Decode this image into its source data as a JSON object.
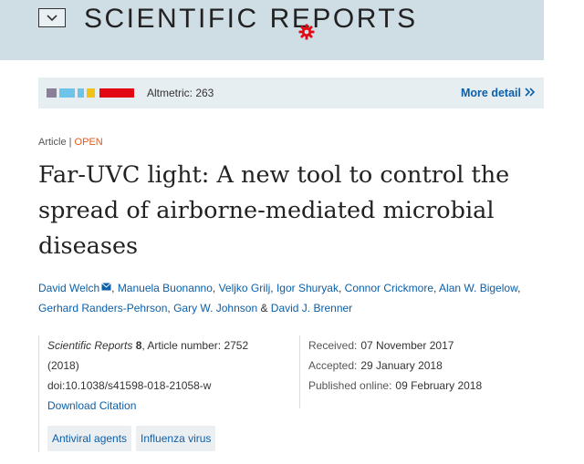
{
  "header": {
    "logo_left": "SCIENTIFIC",
    "logo_right": "REPORTS",
    "menu_icon": "chevron-down-icon"
  },
  "altmetric": {
    "label": "Altmetric: 263",
    "more_detail": "More detail",
    "swatch_colors": [
      "#8a7f96",
      "#6ec3e8",
      "#6ec3e8",
      "#f2c21c",
      "#e30613",
      "#e30613",
      "#e30613"
    ]
  },
  "article": {
    "type": "Article",
    "access": "OPEN",
    "title": "Far-UVC light: A new tool to control the spread of airborne-mediated microbial diseases"
  },
  "authors": [
    {
      "name": "David Welch",
      "mail": true
    },
    {
      "name": "Manuela Buonanno"
    },
    {
      "name": "Veljko Grilj"
    },
    {
      "name": "Igor Shuryak"
    },
    {
      "name": "Connor Crickmore"
    },
    {
      "name": "Alan W. Bigelow"
    },
    {
      "name": "Gerhard Randers-Pehrson"
    },
    {
      "name": "Gary W. Johnson"
    },
    {
      "name": "David J. Brenner"
    }
  ],
  "citation": {
    "journal": "Scientific Reports",
    "volume": "8",
    "article_number_label": ", Article number: 2752",
    "year": "(2018)",
    "doi": "doi:10.1038/s41598-018-21058-w",
    "download": "Download Citation"
  },
  "subjects": [
    "Antiviral agents",
    "Influenza virus"
  ],
  "dates": {
    "received_label": "Received:",
    "received": "07 November 2017",
    "accepted_label": "Accepted:",
    "accepted": "29 January 2018",
    "published_label": "Published online:",
    "published": "09 February 2018"
  },
  "colors": {
    "header_bg": "#cfdde4",
    "link": "#0c5fa8",
    "open": "#e0591a",
    "gear": "#e30613"
  }
}
